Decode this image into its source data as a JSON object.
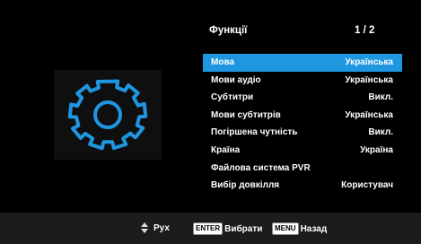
{
  "header": {
    "title": "Функції",
    "page": "1 / 2"
  },
  "menu": {
    "items": [
      {
        "label": "Мова",
        "value": "Українська",
        "selected": true
      },
      {
        "label": "Мови аудіо",
        "value": "Українська"
      },
      {
        "label": "Субтитри",
        "value": "Викл."
      },
      {
        "label": "Мови субтитрів",
        "value": "Українська"
      },
      {
        "label": "Погіршена чутність",
        "value": "Викл."
      },
      {
        "label": "Країна",
        "value": "Україна"
      },
      {
        "label": "Файлова система PVR",
        "value": ""
      },
      {
        "label": "Вибір довкілля",
        "value": "Користувач"
      }
    ]
  },
  "footer": {
    "move_label": "Рух",
    "enter_key": "ENTER",
    "select_label": "Вибрати",
    "menu_key": "MENU",
    "back_label": "Назад"
  },
  "icons": {
    "settings": "gear-icon",
    "navigation": "up-down-arrows-icon"
  },
  "colors": {
    "background": "#000000",
    "highlight": "#1e96e0",
    "gear": "#1e96e0",
    "footer_bar": "#1c1c1c"
  }
}
